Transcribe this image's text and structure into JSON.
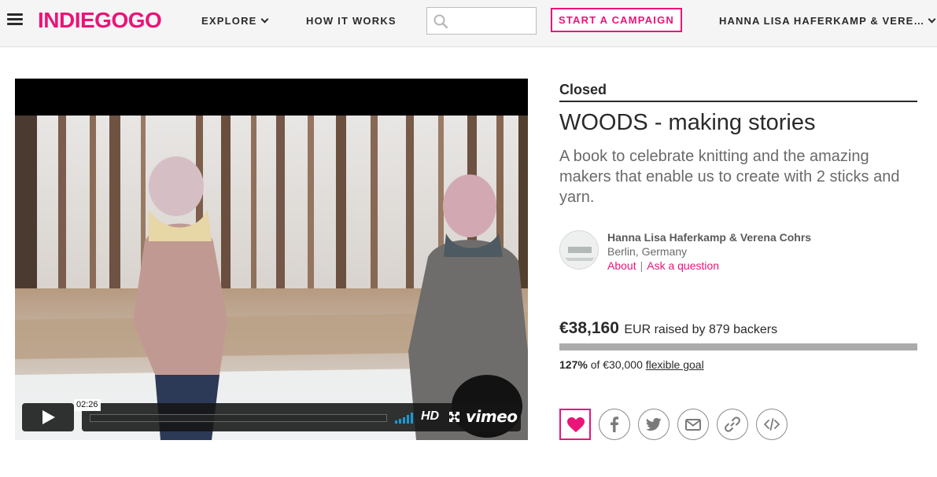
{
  "nav": {
    "logo": "INDIEGOGO",
    "explore_label": "EXPLORE",
    "how_label": "HOW IT WORKS",
    "search_placeholder": "",
    "start_campaign_label": "START A CAMPAIGN",
    "user_label": "HANNA LISA HAFERKAMP & VERE…"
  },
  "video": {
    "timecode": "02:26",
    "hd_label": "HD",
    "vimeo_label": "vimeo",
    "progress": 0
  },
  "campaign": {
    "status": "Closed",
    "title": "WOODS - making stories",
    "tagline": "A book to celebrate knitting and the amazing makers that enable us to create with 2 sticks and yarn.",
    "owner_name": "Hanna Lisa Haferkamp & Verena Cohrs",
    "owner_location": "Berlin, Germany",
    "about_link": "About",
    "link_separator": "|",
    "ask_link": "Ask a question",
    "raised_amount": "€38,160",
    "raised_rest": "EUR raised by 879 backers",
    "funded_fraction": 1.0,
    "goal_percent": "127%",
    "goal_text": "of €30,000",
    "goal_type": "flexible goal"
  },
  "colors": {
    "brand": "#eb1478",
    "text": "#2a2a2a",
    "muted": "#6a6a6a"
  },
  "icons": [
    "menu-icon",
    "chevron-down-icon",
    "search-icon",
    "play-icon",
    "volume-icon",
    "fullscreen-icon",
    "heart-icon",
    "facebook-icon",
    "twitter-icon",
    "email-icon",
    "link-icon",
    "embed-icon"
  ]
}
